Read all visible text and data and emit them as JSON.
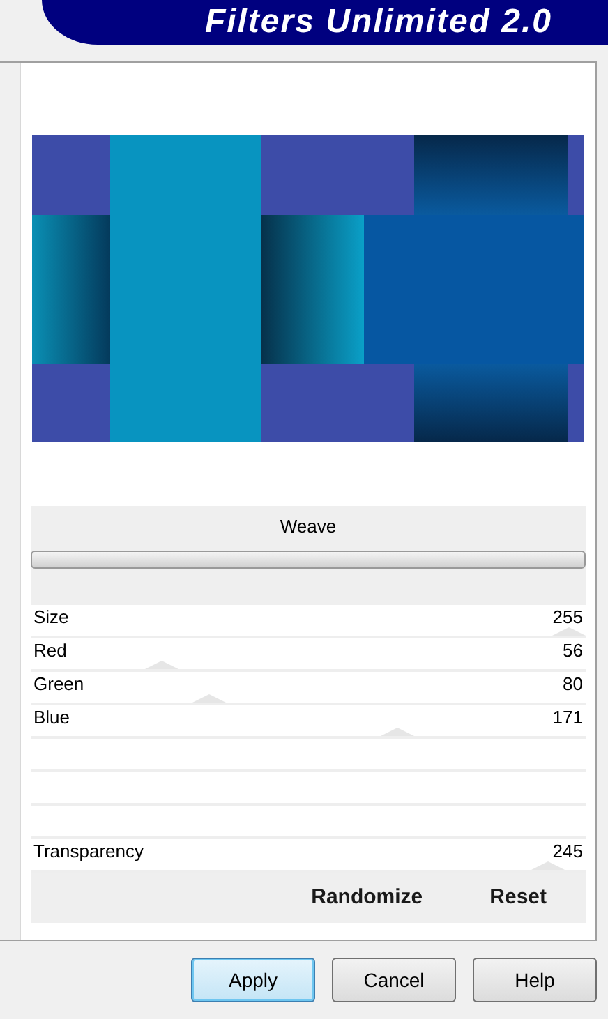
{
  "window": {
    "title": "Filters Unlimited 2.0"
  },
  "filter": {
    "name": "Weave"
  },
  "sliders": [
    {
      "label": "Size",
      "value": "255",
      "level": 1.0
    },
    {
      "label": "Red",
      "value": "56",
      "level": 0.22
    },
    {
      "label": "Green",
      "value": "80",
      "level": 0.31
    },
    {
      "label": "Blue",
      "value": "171",
      "level": 0.67
    },
    {
      "kind": "empty"
    },
    {
      "kind": "empty"
    },
    {
      "kind": "empty"
    },
    {
      "label": "Transparency",
      "value": "245",
      "level": 0.96
    }
  ],
  "actions": [
    "Randomize",
    "Reset"
  ],
  "buttons": [
    {
      "label": "Apply",
      "selected": true
    },
    {
      "label": "Cancel",
      "selected": false
    },
    {
      "label": "Help",
      "selected": false
    }
  ]
}
